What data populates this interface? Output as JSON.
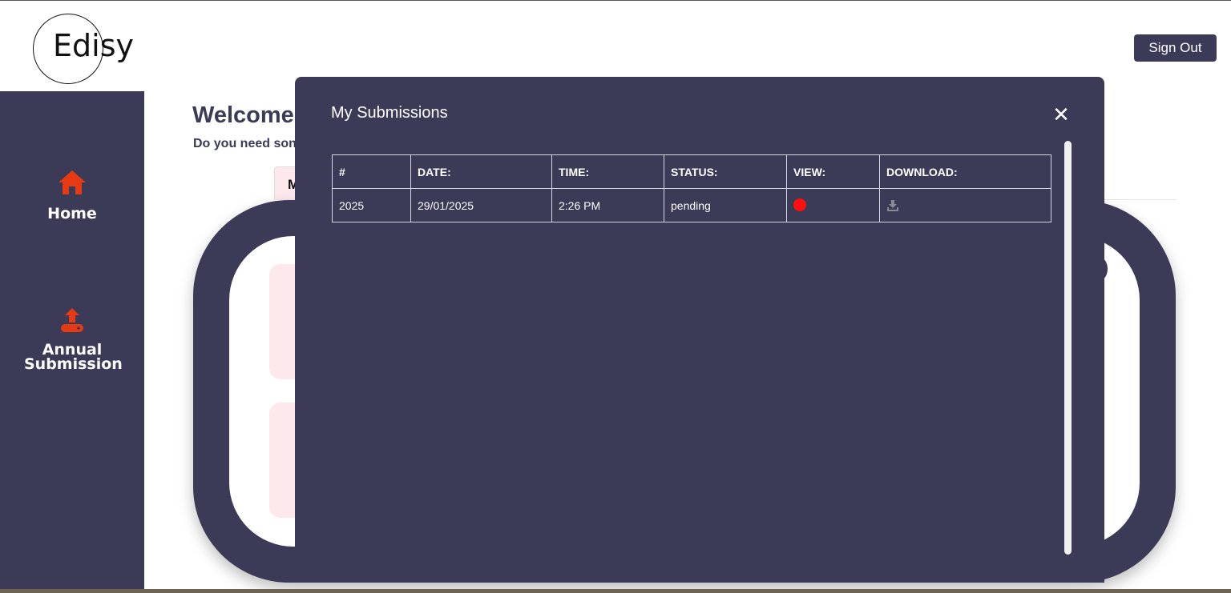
{
  "header": {
    "logo_text": "Edisy",
    "signout_label": "Sign Out"
  },
  "sidebar": {
    "items": [
      {
        "label": "Home",
        "icon": "home-icon"
      },
      {
        "label": "Annual Submission",
        "icon": "upload-icon"
      }
    ]
  },
  "main": {
    "welcome": "Welcome",
    "subline": "Do you need son",
    "tab_label": "M"
  },
  "modal": {
    "title": "My Submissions",
    "close_label": "✕",
    "table": {
      "headers": [
        "#",
        "DATE:",
        "TIME:",
        "STATUS:",
        "VIEW:",
        "DOWNLOAD:"
      ],
      "rows": [
        {
          "num": "2025",
          "date": "29/01/2025",
          "time": "2:26 PM",
          "status": "pending",
          "view": "red-dot",
          "download": "download-icon"
        }
      ]
    }
  },
  "colors": {
    "primary": "#3b3a57",
    "accent": "#e63a12",
    "pink": "#fde8ec",
    "view_dot": "#ff1010"
  }
}
